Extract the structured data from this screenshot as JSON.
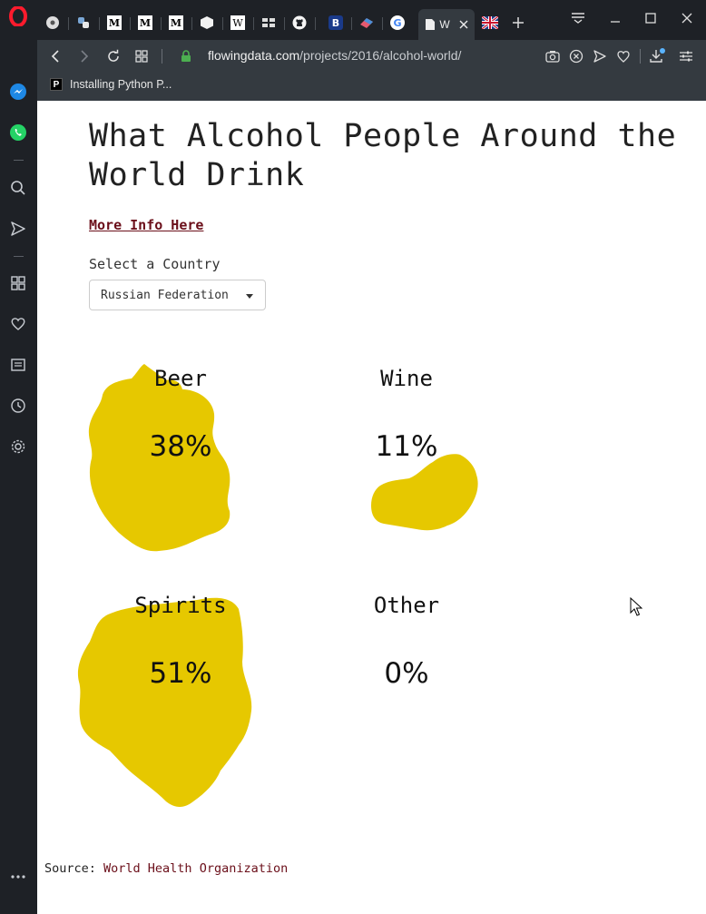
{
  "browser": {
    "tabs": [
      {
        "icon": "opera-logo-icon",
        "label": ""
      },
      {
        "icon": "steering-wheel-icon",
        "label": ""
      },
      {
        "icon": "python-icon",
        "label": ""
      },
      {
        "icon": "medium-m-icon",
        "label": "M"
      },
      {
        "icon": "medium-m-icon",
        "label": "M"
      },
      {
        "icon": "medium-m-icon",
        "label": "M"
      },
      {
        "icon": "cube-icon",
        "label": ""
      },
      {
        "icon": "wikipedia-icon",
        "label": "W"
      },
      {
        "icon": "grid-icon",
        "label": ""
      },
      {
        "icon": "github-icon",
        "label": ""
      },
      {
        "icon": "b-icon",
        "label": "B"
      },
      {
        "icon": "eraser-icon",
        "label": ""
      },
      {
        "icon": "google-icon",
        "label": "G"
      },
      {
        "icon": "document-icon",
        "label": "W"
      },
      {
        "icon": "uk-flag-icon",
        "label": ""
      }
    ],
    "active_tab_label": "W",
    "url_host": "flowingdata.com",
    "url_path": "/projects/2016/alcohol-world/",
    "bookmark_label": "Installing Python P...",
    "bookmark_favicon": "P"
  },
  "page": {
    "title": "What Alcohol People Around the World Drink",
    "more_info": "More Info Here",
    "select_label": "Select a Country",
    "selected_country": "Russian Federation",
    "source_label": "Source:",
    "source_link": "World Health Organization"
  },
  "chart_data": {
    "type": "bubble",
    "country": "Russian Federation",
    "categories": [
      "Beer",
      "Wine",
      "Spirits",
      "Other"
    ],
    "values": [
      38,
      11,
      51,
      0
    ],
    "labels": [
      "38%",
      "11%",
      "51%",
      "0%"
    ],
    "color": "#e6c800"
  },
  "colors": {
    "accent": "#e6c800",
    "link": "#6b0f1a",
    "chrome_dark": "#1e2126",
    "chrome_mid": "#343a40"
  }
}
